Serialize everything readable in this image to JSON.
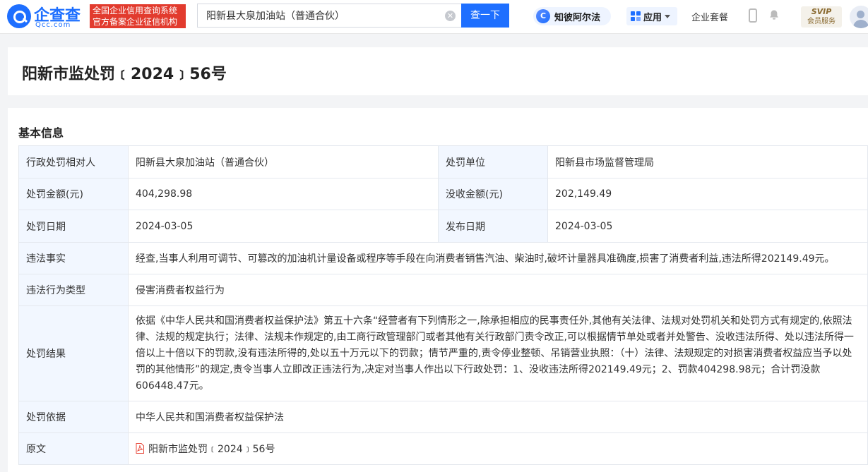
{
  "header": {
    "logo_name": "企查查",
    "logo_domain": "Qcc.com",
    "slogan_line1": "全国企业信用查询系统",
    "slogan_line2": "官方备案企业征信机构",
    "search_value": "阳新县大泉加油站（普通合伙）",
    "search_button": "查一下",
    "zhibi_label": "知彼阿尔法",
    "apps_label": "应用",
    "package_label": "企业套餐",
    "vip_top": "SVIP",
    "vip_bottom": "会员服务"
  },
  "page": {
    "title": "阳新市监处罚﹝2024﹞56号"
  },
  "basic_info": {
    "section_title": "基本信息",
    "party_label": "行政处罚相对人",
    "party_value": "阳新县大泉加油站（普通合伙）",
    "unit_label": "处罚单位",
    "unit_value": "阳新县市场监督管理局",
    "fine_label": "处罚金额(元)",
    "fine_value": "404,298.98",
    "confiscate_label": "没收金额(元)",
    "confiscate_value": "202,149.49",
    "date_label": "处罚日期",
    "date_value": "2024-03-05",
    "publish_label": "发布日期",
    "publish_value": "2024-03-05",
    "facts_label": "违法事实",
    "facts_value": "经查,当事人利用可调节、可篡改的加油机计量设备或程序等手段在向消费者销售汽油、柴油时,破坏计量器具准确度,损害了消费者利益,违法所得202149.49元。",
    "type_label": "违法行为类型",
    "type_value": "侵害消费者权益行为",
    "result_label": "处罚结果",
    "result_value": "依据《中华人民共和国消费者权益保护法》第五十六条“经营者有下列情形之一,除承担相应的民事责任外,其他有关法律、法规对处罚机关和处罚方式有规定的,依照法律、法规的规定执行；法律、法规未作规定的,由工商行政管理部门或者其他有关行政部门责令改正,可以根据情节单处或者并处警告、没收违法所得、处以违法所得一倍以上十倍以下的罚款,没有违法所得的,处以五十万元以下的罚款；情节严重的,责令停业整顿、吊销营业执照：（十）法律、法规规定的对损害消费者权益应当予以处罚的其他情形”的规定,责令当事人立即改正违法行为,决定对当事人作出以下行政处罚：1、没收违法所得202149.49元；2、罚款404298.98元；合计罚没款606448.47元。",
    "basis_label": "处罚依据",
    "basis_value": "中华人民共和国消费者权益保护法",
    "original_label": "原文",
    "original_value": "阳新市监处罚﹝2024﹞56号"
  },
  "colors": {
    "brand": "#1e6fff",
    "slogan_bg": "#e23b2e",
    "label_bg": "#f2f7ff"
  }
}
